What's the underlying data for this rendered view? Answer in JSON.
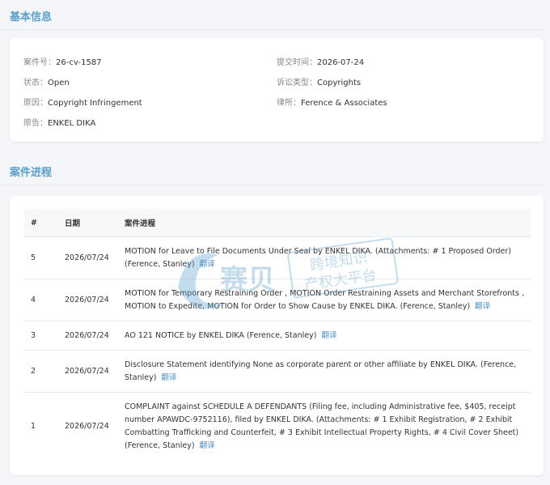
{
  "sections": {
    "basic_title": "基本信息",
    "progress_title": "案件进程"
  },
  "basic": {
    "case_no_label": "案件号：",
    "case_no": "26-cv-1587",
    "filed_label": "提交时间：",
    "filed": "2026-07-24",
    "status_label": "状态：",
    "status": "Open",
    "type_label": "诉讼类型：",
    "type": "Copyrights",
    "cause_label": "原因：",
    "cause": "Copyright Infringement",
    "firm_label": "律所：",
    "firm": "Ference & Associates",
    "plaintiff_label": "原告：",
    "plaintiff": "ENKEL DIKA"
  },
  "table": {
    "headers": [
      "#",
      "日期",
      "案件进程"
    ],
    "translate_label": "翻译",
    "rows": [
      {
        "num": "5",
        "date": "2026/07/24",
        "text": "MOTION for Leave to File Documents Under Seal by ENKEL DIKA. (Attachments: # 1 Proposed Order) (Ference, Stanley)"
      },
      {
        "num": "4",
        "date": "2026/07/24",
        "text": "MOTION for Temporary Restraining Order , MOTION Order Restraining Assets and Merchant Storefronts , MOTION to Expedite, MOTION for Order to Show Cause by ENKEL DIKA. (Ference, Stanley)"
      },
      {
        "num": "3",
        "date": "2026/07/24",
        "text": "AO 121 NOTICE by ENKEL DIKA (Ference, Stanley)"
      },
      {
        "num": "2",
        "date": "2026/07/24",
        "text": "Disclosure Statement identifying None as corporate parent or other affiliate by ENKEL DIKA. (Ference, Stanley)"
      },
      {
        "num": "1",
        "date": "2026/07/24",
        "text": "COMPLAINT against SCHEDULE A DEFENDANTS (Filing fee, including Administrative fee, $405, receipt number APAWDC-9752116), filed by ENKEL DIKA. (Attachments: # 1 Exhibit Registration, # 2 Exhibit Combatting Trafficking and Counterfeit, # 3 Exhibit Intellectual Property Rights, # 4 Civil Cover Sheet) (Ference, Stanley)"
      }
    ]
  },
  "watermark": {
    "brand": "赛贝",
    "slogan_line1": "跨境知识",
    "slogan_line2": "产权大平台"
  }
}
